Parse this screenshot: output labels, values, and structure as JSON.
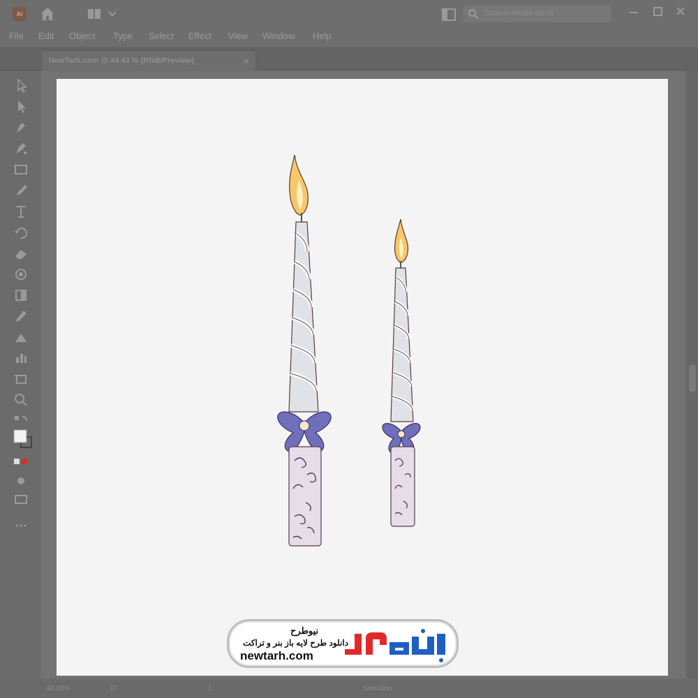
{
  "app": {
    "icon_label": "Ai",
    "search_placeholder": "Search Adobe Stock"
  },
  "menu": [
    "File",
    "Edit",
    "Object",
    "Type",
    "Select",
    "Effect",
    "View",
    "Window",
    "Help"
  ],
  "document_tab": {
    "title": "NewTarh.com @ 44.43 % (RGB/Preview)",
    "close_label": "✕"
  },
  "status": {
    "zoom": "44.43%",
    "rotation": "0°",
    "artboard_number": "1",
    "tool_name": "Selection"
  },
  "logo": {
    "fa_name": "نیوطرح",
    "fa_tagline": "دانلود طرح لایه باز بنر و تراکت",
    "url": "newtarh.com",
    "mark_text": "نیوطرح"
  },
  "colors": {
    "chrome": "#6e6e6e",
    "artboard": "#f4f4f5",
    "logo_blue": "#1f5fc4",
    "logo_red": "#e02a2a",
    "bow": "#6d6db8"
  }
}
